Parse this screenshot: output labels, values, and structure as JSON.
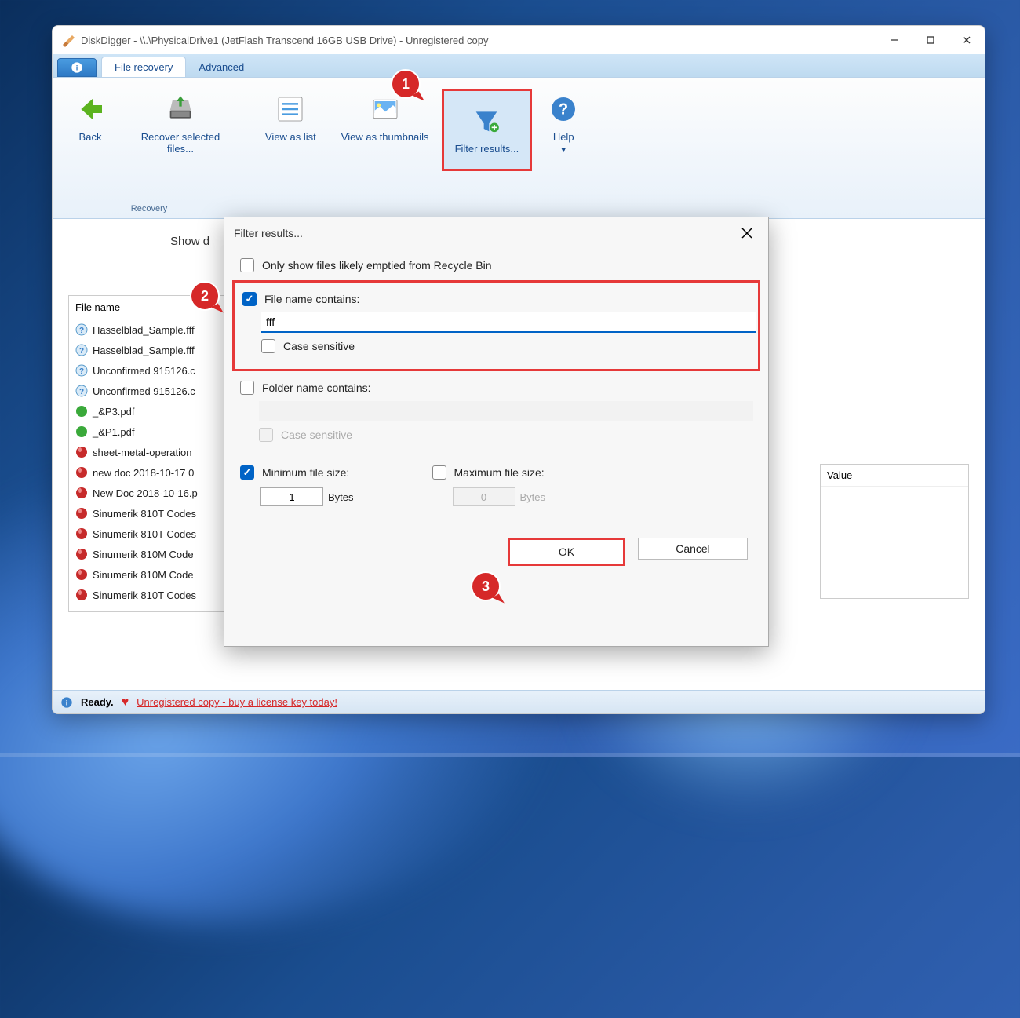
{
  "window_title": "DiskDigger - \\\\.\\PhysicalDrive1 (JetFlash Transcend 16GB USB Drive) - Unregistered copy",
  "tabs": {
    "file_recovery": "File recovery",
    "advanced": "Advanced"
  },
  "toolbar": {
    "back": "Back",
    "recover": "Recover selected files...",
    "recovery_group": "Recovery",
    "view_list": "View as list",
    "view_thumbs": "View as thumbnails",
    "filter": "Filter results...",
    "help": "Help"
  },
  "body": {
    "show_label": "Show d",
    "file_name_header": "File name",
    "value_header": "Value"
  },
  "files": [
    {
      "name": "Hasselblad_Sample.fff",
      "type": "unknown"
    },
    {
      "name": "Hasselblad_Sample.fff",
      "type": "unknown"
    },
    {
      "name": "Unconfirmed 915126.c",
      "type": "unknown"
    },
    {
      "name": "Unconfirmed 915126.c",
      "type": "unknown"
    },
    {
      "name": "_&P3.pdf",
      "type": "ok"
    },
    {
      "name": "_&P1.pdf",
      "type": "ok"
    },
    {
      "name": "sheet-metal-operation",
      "type": "bad"
    },
    {
      "name": "new doc 2018-10-17 0",
      "type": "bad"
    },
    {
      "name": "New Doc 2018-10-16.p",
      "type": "bad"
    },
    {
      "name": "Sinumerik 810T Codes",
      "type": "bad"
    },
    {
      "name": "Sinumerik 810T Codes",
      "type": "bad"
    },
    {
      "name": "Sinumerik 810M Code",
      "type": "bad"
    },
    {
      "name": "Sinumerik 810M Code",
      "type": "bad"
    },
    {
      "name": "Sinumerik 810T Codes",
      "type": "bad"
    }
  ],
  "dialog": {
    "title": "Filter results...",
    "recycle_bin": "Only show files likely emptied from Recycle Bin",
    "filename_contains": "File name contains:",
    "filename_value": "fff",
    "case_sensitive": "Case sensitive",
    "folder_contains": "Folder name contains:",
    "min_size": "Minimum file size:",
    "min_value": "1",
    "max_size": "Maximum file size:",
    "max_value": "0",
    "bytes": "Bytes",
    "ok": "OK",
    "cancel": "Cancel"
  },
  "status": {
    "ready": "Ready.",
    "link": "Unregistered copy - buy a license key today!"
  },
  "callouts": {
    "c1": "1",
    "c2": "2",
    "c3": "3"
  }
}
